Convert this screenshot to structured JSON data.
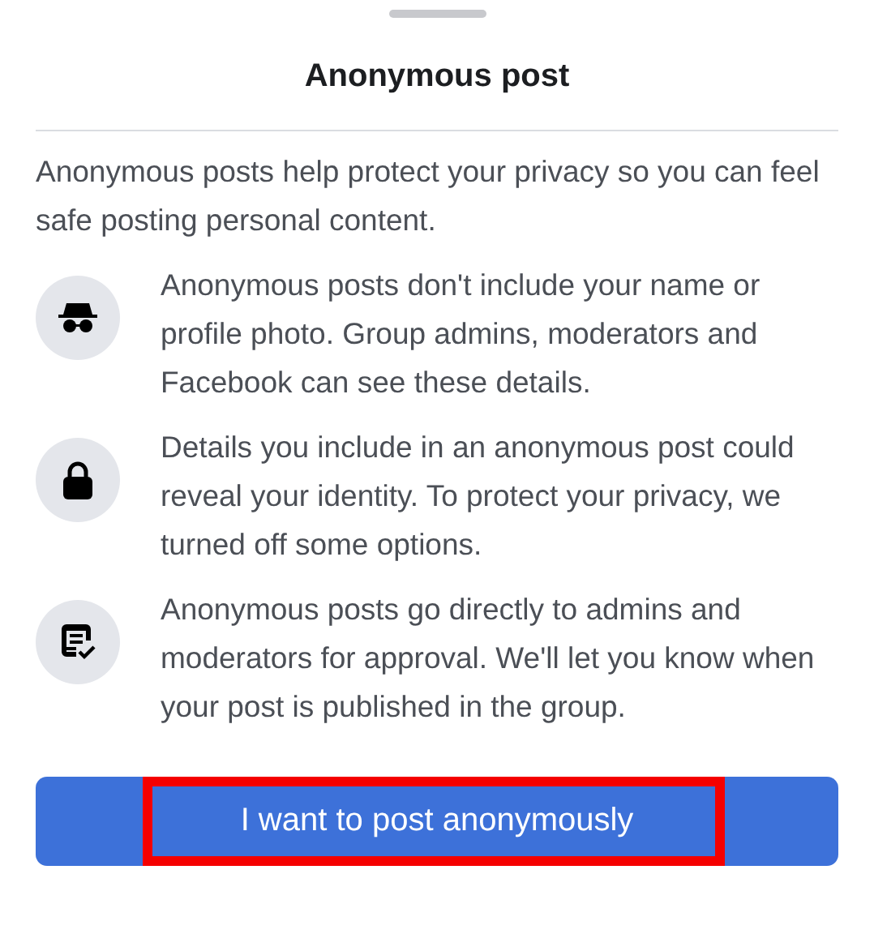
{
  "sheet": {
    "title": "Anonymous post",
    "intro": "Anonymous posts help protect your privacy so you can feel safe posting personal content."
  },
  "items": [
    {
      "kind": "incognito",
      "text": "Anonymous posts don't include your name or profile photo. Group admins, moderators and Facebook can see these details."
    },
    {
      "kind": "lock",
      "text": "Details you include in an anonymous post could reveal your identity. To protect your privacy, we turned off some options."
    },
    {
      "kind": "approval",
      "text": "Anonymous posts go directly to admins and moderators for approval. We'll let you know when your post is published in the group."
    }
  ],
  "button": {
    "label": "I want to post anonymously",
    "highlighted": true
  }
}
